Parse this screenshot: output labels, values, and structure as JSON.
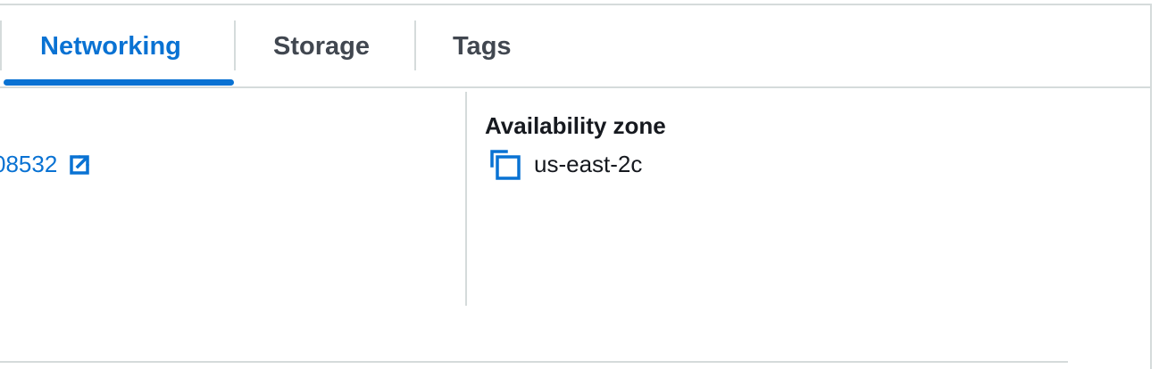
{
  "tabs": [
    {
      "label": "Networking",
      "active": true
    },
    {
      "label": "Storage",
      "active": false
    },
    {
      "label": "Tags",
      "active": false
    }
  ],
  "left_panel": {
    "link_text": "08532",
    "link_icon": "external-link-icon"
  },
  "right_panel": {
    "availability_zone_label": "Availability zone",
    "availability_zone_value": "us-east-2c",
    "copy_icon": "copy-icon"
  },
  "colors": {
    "accent": "#0972d3",
    "text": "#16191f",
    "tab_inactive": "#414750",
    "border": "#d5dbdb"
  }
}
